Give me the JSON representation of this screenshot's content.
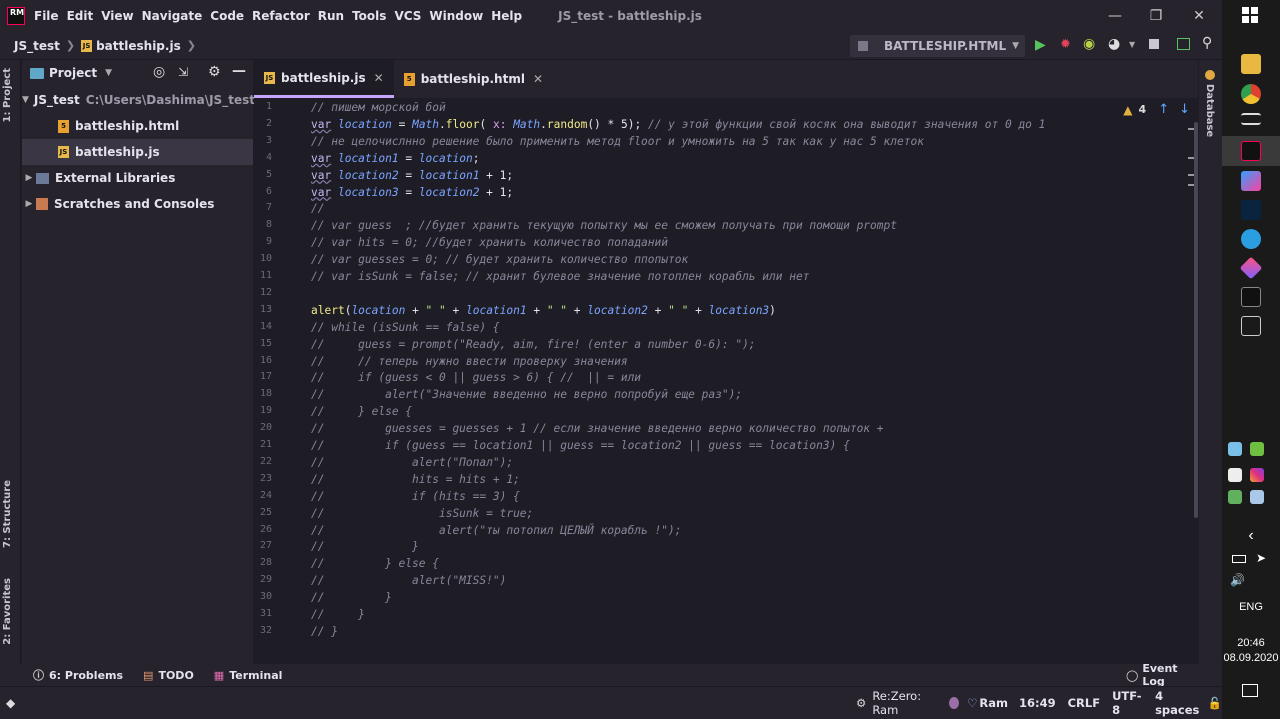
{
  "app": {
    "logo": "RM",
    "window_title": "JS_test - battleship.js"
  },
  "menu": [
    "File",
    "Edit",
    "View",
    "Navigate",
    "Code",
    "Refactor",
    "Run",
    "Tools",
    "VCS",
    "Window",
    "Help"
  ],
  "breadcrumb": [
    "JS_test",
    "battleship.js"
  ],
  "run_config": {
    "label": "BATTLESHIP.HTML"
  },
  "left_tabs": {
    "project": "1: Project",
    "structure": "7: Structure",
    "favorites": "2: Favorites"
  },
  "right_tabs": {
    "database": "Database"
  },
  "project": {
    "header": "Project",
    "root": {
      "name": "JS_test",
      "path": "C:\\Users\\Dashima\\JS_test"
    },
    "files": [
      "battleship.html",
      "battleship.js"
    ],
    "external": "External Libraries",
    "scratches": "Scratches and Consoles"
  },
  "editor": {
    "tabs": [
      {
        "label": "battleship.js",
        "active": true
      },
      {
        "label": "battleship.html",
        "active": false
      }
    ],
    "warnings": "4",
    "lines": [
      "// пишем морской бой",
      "var location = Math.floor( x: Math.random() * 5); // у этой функции свой косяк она выводит значения от 0 до 1",
      "// не целочислнно решение было применить метод floor и умножить на 5 так как у нас 5 клеток",
      "var location1 = location;",
      "var location2 = location1 + 1;",
      "var location3 = location2 + 1;",
      "//",
      "// var guess  ; //будет хранить текущую попытку мы ее сможем получать при помощи prompt",
      "// var hits = 0; //будет хранить количество попаданий",
      "// var guesses = 0; // будет хранить количество ппопыток",
      "// var isSunk = false; // хранит булевое значение потоплен корабль или нет",
      "",
      "alert(location + \" \" + location1 + \" \" + location2 + \" \" + location3)",
      "// while (isSunk == false) {",
      "//     guess = prompt(\"Ready, aim, fire! (enter a number 0-6): \");",
      "//     // теперь нужно ввести проверку значения",
      "//     if (guess < 0 || guess > 6) { //  || = или",
      "//         alert(\"Значение введенно не верно попробуй еще раз\");",
      "//     } else {",
      "//         guesses = guesses + 1 // если значение введенно верно количество попыток +",
      "//         if (guess == location1 || guess == location2 || guess == location3) {",
      "//             alert(\"Попал\");",
      "//             hits = hits + 1;",
      "//             if (hits == 3) {",
      "//                 isSunk = true;",
      "//                 alert(\"ты потопил ЦЕЛЫЙ корабль !\");",
      "//             }",
      "//         } else {",
      "//             alert(\"MISS!\")",
      "//         }",
      "//     }",
      "// }"
    ]
  },
  "toolwindows": {
    "problems": "6: Problems",
    "todo": "TODO",
    "terminal": "Terminal",
    "event_log": "Event Log"
  },
  "status": {
    "theme": "Re:Zero: Ram",
    "plugin": "Ram",
    "position": "16:49",
    "line_sep": "CRLF",
    "encoding": "UTF-8",
    "indent": "4 spaces"
  },
  "os": {
    "lang": "ENG",
    "time": "20:46",
    "date": "08.09.2020"
  },
  "colors": {
    "accent": "#c6a5ff",
    "background": "#1e1c25",
    "panel": "#26232d"
  }
}
